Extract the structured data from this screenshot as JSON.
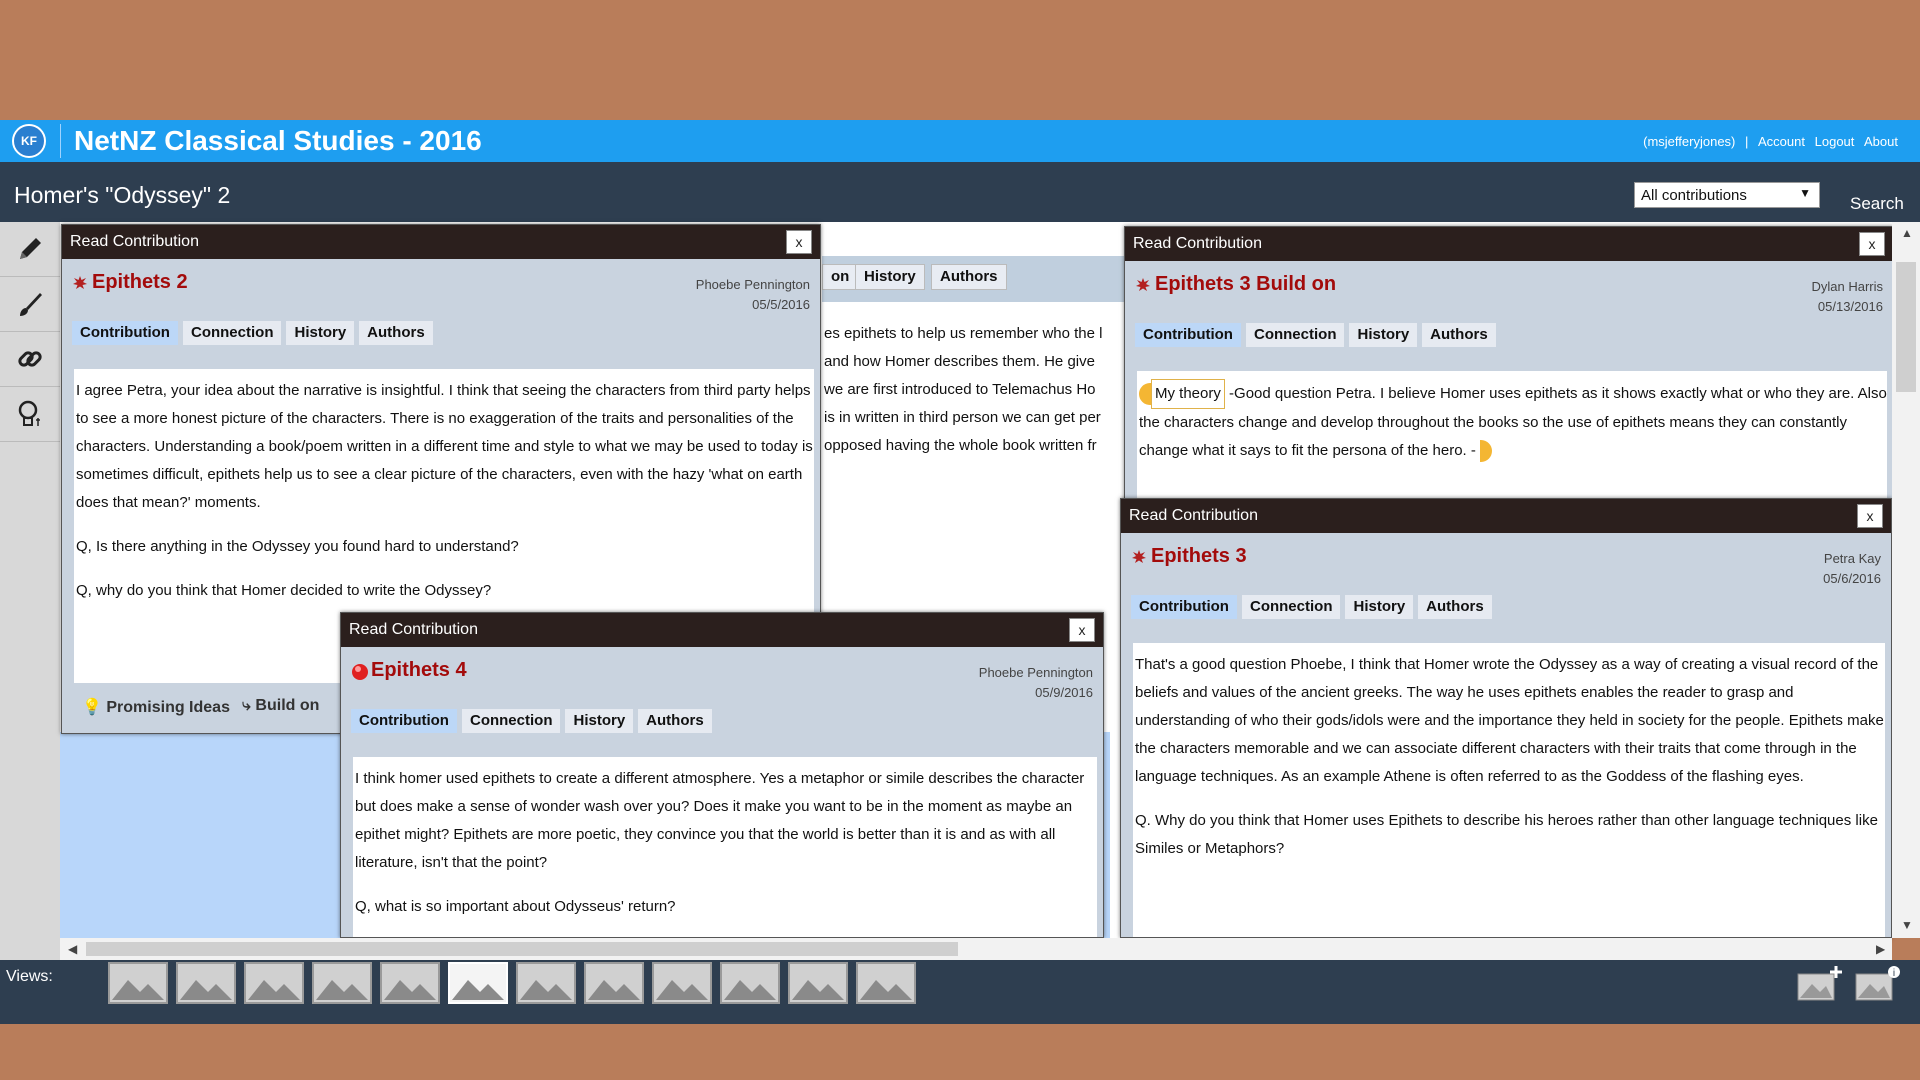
{
  "header": {
    "logo_text": "KF",
    "app_title": "NetNZ Classical Studies - 2016",
    "user": "(msjefferyjones)",
    "links": [
      "Account",
      "Logout",
      "About"
    ]
  },
  "subheader": {
    "page_title": "Homer's \"Odyssey\" 2",
    "filter_selected": "All contributions",
    "search_label": "Search"
  },
  "background_window": {
    "tabs": [
      "on",
      "History",
      "Authors"
    ],
    "lines": [
      "es epithets to help us remember who the l",
      "and how Homer describes them. He give",
      "we are first introduced to Telemachus Ho",
      "is in written in third person we can get per",
      " opposed having the whole book written fr"
    ]
  },
  "windows": {
    "common": {
      "title_bar": "Read Contribution",
      "close": "x",
      "tabs": [
        "Contribution",
        "Connection",
        "History",
        "Authors"
      ]
    },
    "w1": {
      "title": "Epithets 2",
      "author": "Phoebe Pennington",
      "date": "05/5/2016",
      "paragraphs": [
        "I agree Petra, your idea about the narrative is insightful. I think that seeing the characters from third party helps to see a more honest picture of the characters. There is no exaggeration of the traits and personalities of the characters. Understanding a book/poem written in a different time and style to what we may be used to today is sometimes difficult, epithets help us to see a clear picture of the characters, even with the hazy 'what on earth does that mean?' moments.",
        "Q, Is there anything in the Odyssey you found hard to understand?",
        "Q, why do you think that Homer decided to write the Odyssey?"
      ],
      "footer": [
        "Promising Ideas",
        "Build on"
      ]
    },
    "w2": {
      "title": "Epithets 3 Build on",
      "author": "Dylan Harris",
      "date": "05/13/2016",
      "scaffold": "My theory",
      "text": " -Good question Petra. I believe Homer uses epithets as it shows exactly what or who they are. Also the characters change and develop throughout the books so the use of epithets means they can constantly change what it says to fit the persona of the hero. - "
    },
    "w3": {
      "title": "Epithets 3",
      "author": "Petra Kay",
      "date": "05/6/2016",
      "paragraphs": [
        "That's a good question Phoebe, I think that Homer wrote the Odyssey as a way of creating a visual record of the beliefs and values of the ancient greeks. The way he uses epithets enables the reader to grasp and understanding of who their gods/idols were and the importance they held in society for the people. Epithets make the characters memorable and we can associate different characters with their traits that come through in the language techniques. As an example Athene is often referred to as the Goddess of the flashing eyes.",
        "Q. Why do you think that Homer uses Epithets to describe his heroes rather than other language techniques like Similes or Metaphors?"
      ]
    },
    "w4": {
      "title": "Epithets 4",
      "author": "Phoebe Pennington",
      "date": "05/9/2016",
      "paragraphs": [
        "I think homer used epithets to create a different atmosphere. Yes a metaphor or simile describes the character but does make a sense of wonder wash over you? Does it make you want to be in the moment as maybe an epithet might? Epithets are more poetic, they convince you that the world is better than it is and as with all literature, isn't that the point?",
        "Q, what is so important about Odysseus' return?"
      ]
    }
  },
  "views": {
    "label": "Views:",
    "count": 12,
    "selected_index": 5
  },
  "colors": {
    "accent": "#1e9ef0",
    "navy": "#2e3e50",
    "title_red": "#a30b0b",
    "window_bar": "#2b1f1d"
  }
}
